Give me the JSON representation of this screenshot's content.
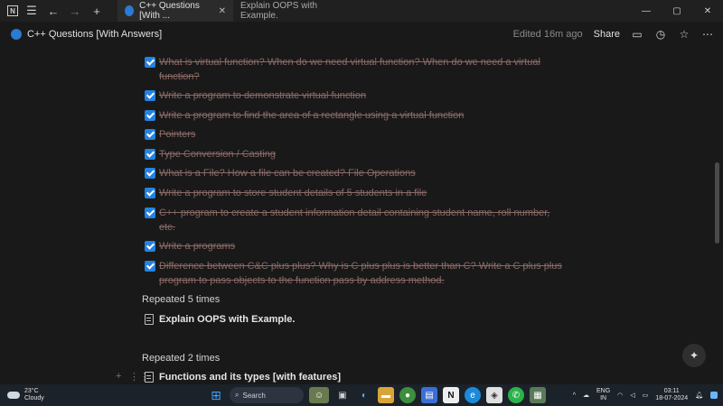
{
  "titlebar": {
    "tabs": [
      {
        "label": "C++ Questions [With ..."
      },
      {
        "label": "Explain OOPS with Example."
      }
    ]
  },
  "header": {
    "title": "C++ Questions [With Answers]",
    "edited": "Edited 16m ago",
    "share": "Share"
  },
  "todos": [
    {
      "text": "What is virtual function? When do we need virtual function? When do we need a virtual function?"
    },
    {
      "text": "Write a program to demonstrate virtual function"
    },
    {
      "text": "Write a program to find the area of a rectangle using a virtual function"
    },
    {
      "text": "Pointers"
    },
    {
      "text": "Type Conversion / Casting"
    },
    {
      "text": "What is a File? How a file can be created? File Operations"
    },
    {
      "text": "Write a program to store student details of 5 students in a file"
    },
    {
      "text": "C++ program to create a student information detail containing student name, roll number, etc."
    },
    {
      "text": "Write a programs"
    },
    {
      "text": "Difference between C&C plus plus? Why is C plus plus is better than C? Write a C plus plus program to pass objects to the function pass by address method."
    }
  ],
  "sections": [
    {
      "heading": "Repeated 5 times",
      "page": "Explain OOPS with Example."
    },
    {
      "heading": "Repeated 2 times",
      "page": "Functions and its types [with features]"
    }
  ],
  "taskbar": {
    "weather_temp": "23°C",
    "weather_desc": "Cloudy",
    "search": "Search",
    "lang1": "ENG",
    "lang2": "IN",
    "time": "03:11",
    "date": "18-07-2024"
  }
}
